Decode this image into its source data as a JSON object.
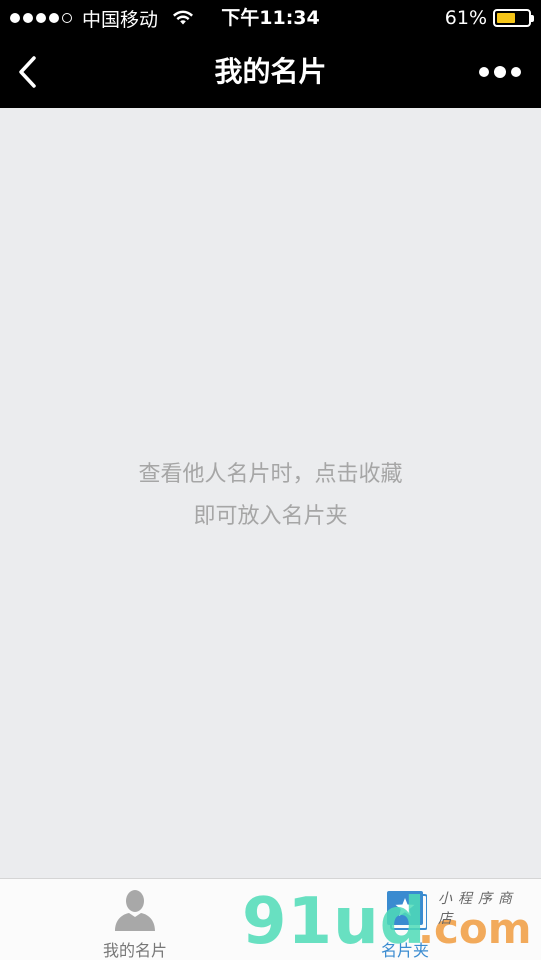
{
  "status_bar": {
    "carrier": "中国移动",
    "time": "下午11:34",
    "battery_percent_label": "61%",
    "battery_level": 0.61,
    "signal_dots_filled": 4,
    "signal_dots_total": 5,
    "battery_color": "#f5c518"
  },
  "nav": {
    "title": "我的名片",
    "back_icon": "chevron-left-icon",
    "more_icon": "more-dots-icon"
  },
  "main": {
    "empty_message": "查看他人名片时，点击收藏即可放入名片夹",
    "background": "#ebecee"
  },
  "tab_bar": {
    "tabs": [
      {
        "label": "我的名片",
        "icon": "person-icon",
        "active": false
      },
      {
        "label": "名片夹",
        "icon": "star-card-icon",
        "active": true
      }
    ],
    "active_color": "#3a8bd0"
  },
  "watermark": {
    "main_text": "91ud",
    "com_text": ".com",
    "small_text": "小程序商店"
  }
}
